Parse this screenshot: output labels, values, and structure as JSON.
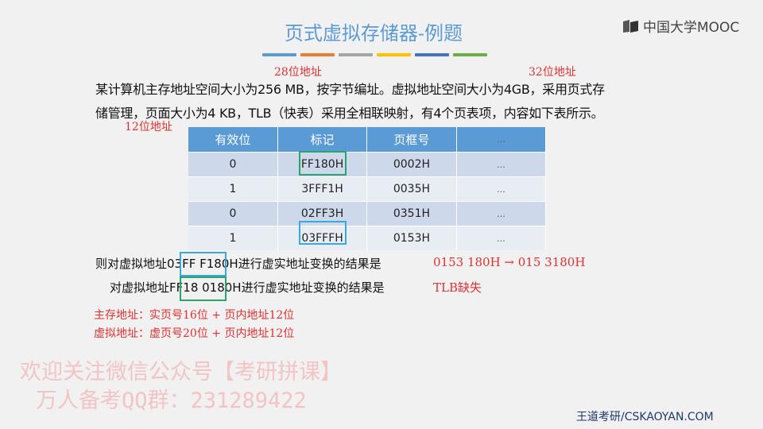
{
  "title": "页式虚拟存储器-例题",
  "logo": {
    "icon": "mooc-book-icon",
    "text": "中国大学MOOC"
  },
  "accent_bars": [
    "#5b9bd5",
    "#ed7d31",
    "#a5a5a5",
    "#ffc000",
    "#4472c4",
    "#70ad47"
  ],
  "annotations": {
    "main_bits": "28位地址",
    "virtual_bits": "32位地址",
    "offset_bits": "12位地址"
  },
  "paragraph": {
    "line1": "某计算机主存地址空间大小为256 MB，按字节编址。虚拟地址空间大小为4GB，采用页式存",
    "line2": "储管理，页面大小为4 KB，TLB（快表）采用全相联映射，有4个页表项，内容如下表所示。"
  },
  "table": {
    "headers": [
      "有效位",
      "标记",
      "页框号",
      "…"
    ],
    "rows": [
      [
        "0",
        "FF180H",
        "0002H",
        "…"
      ],
      [
        "1",
        "3FFF1H",
        "0035H",
        "…"
      ],
      [
        "0",
        "02FF3H",
        "0351H",
        "…"
      ],
      [
        "1",
        "03FFFH",
        "0153H",
        "…"
      ]
    ]
  },
  "questions": {
    "q1_prefix": "则对虚拟地址",
    "q1_addr": "03FF F180H",
    "q1_suffix": "进行虚实地址变换的结果是",
    "q1_answer": "0153 180H → 015 3180H",
    "q2_prefix": "对虚拟地址",
    "q2_addr": "FF18 0180H",
    "q2_suffix": "进行虚实地址变换的结果是",
    "q2_answer": "TLB缺失"
  },
  "notes": {
    "main_addr": "主存地址：实页号16位 + 页内地址12位",
    "virtual_addr": "虚拟地址：虚页号20位 + 页内地址12位"
  },
  "watermark": {
    "line1": "欢迎关注微信公众号【考研拼课】",
    "line2": "万人备考QQ群：231289422"
  },
  "footer": "王道考研/CSKAOYAN.COM",
  "highlight_colors": {
    "green": "#2aa56a",
    "blue": "#3aa8d8"
  }
}
